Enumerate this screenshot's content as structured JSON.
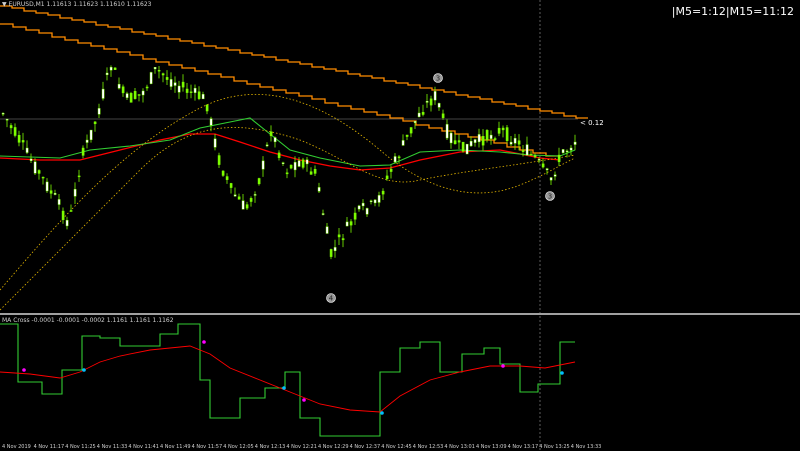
{
  "chart": {
    "symbol_info": "EURUSD,M1  1.11613 1.11623 1.11610 1.11623",
    "timer": "|M5=1:12|M15=11:12",
    "price_label": "< 0.12",
    "indicator_info": "MA Cross -0.0001 -0.0001 -0.0002  1.1161  1.1161  1.1162",
    "markers": [
      "3",
      "4",
      "3"
    ]
  },
  "time_axis": [
    "4 Nov 2019",
    "4 Nov 11:17",
    "4 Nov 11:25",
    "4 Nov 11:33",
    "4 Nov 11:41",
    "4 Nov 11:49",
    "4 Nov 11:57",
    "4 Nov 12:05",
    "4 Nov 12:13",
    "4 Nov 12:21",
    "4 Nov 12:29",
    "4 Nov 12:37",
    "4 Nov 12:45",
    "4 Nov 12:53",
    "4 Nov 13:01",
    "4 Nov 13:09",
    "4 Nov 13:17",
    "4 Nov 13:25",
    "4 Nov 13:33"
  ],
  "colors": {
    "background": "#000000",
    "candles": "#7cfc00",
    "ma_fast": "#ff8c00",
    "ma_red": "#ff0000",
    "ma_green": "#32cd32",
    "dotted_band": "#e6b800",
    "separator": "#ffffff"
  }
}
